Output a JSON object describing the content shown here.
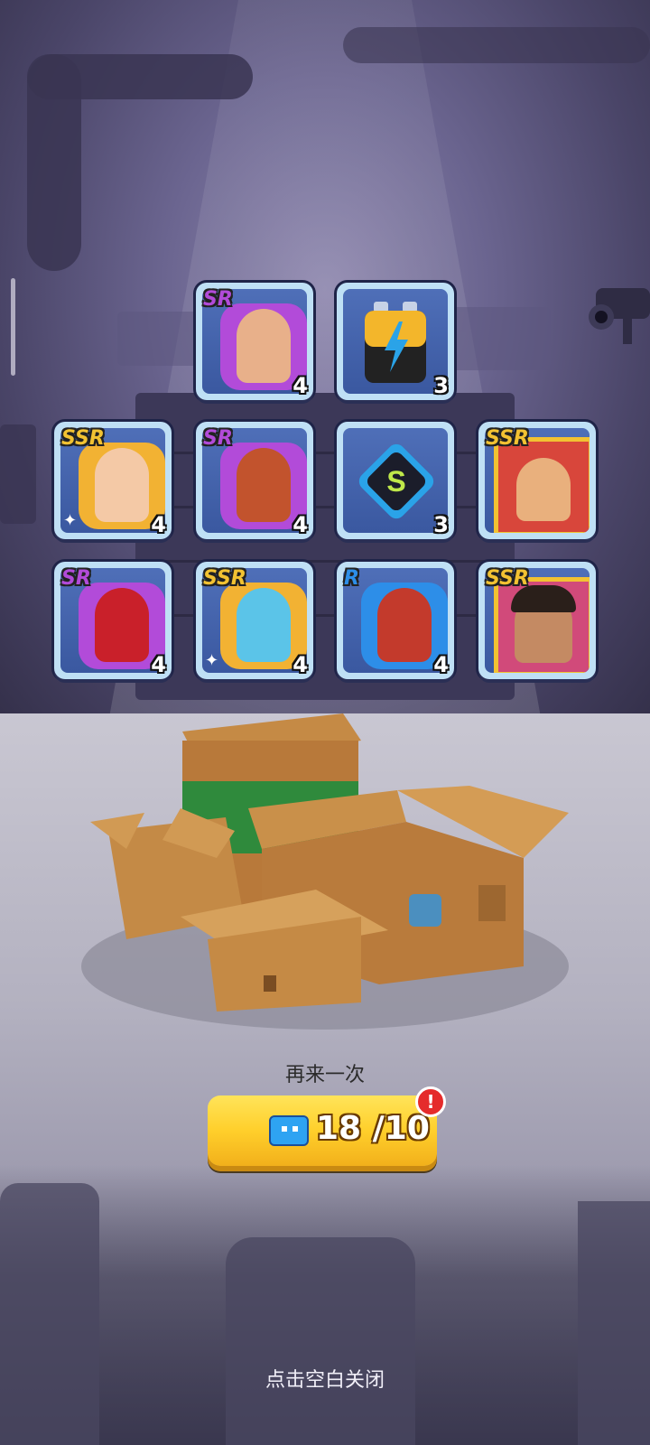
{
  "rewards": [
    {
      "rarity": "SR",
      "count": "4",
      "kind": "hero-shard",
      "color": "#b24bd9"
    },
    {
      "rarity": "",
      "count": "3",
      "kind": "energy-battery",
      "color": "#f3b62b"
    },
    {
      "rarity": "SSR",
      "count": "4",
      "kind": "hero-shard",
      "color": "#f2b233"
    },
    {
      "rarity": "SR",
      "count": "4",
      "kind": "hero-shard",
      "color": "#b24bd9"
    },
    {
      "rarity": "",
      "count": "3",
      "kind": "s-token",
      "color": "#2aa3e8"
    },
    {
      "rarity": "SSR",
      "count": "",
      "kind": "hero-card",
      "color": "#f2c232"
    },
    {
      "rarity": "SR",
      "count": "4",
      "kind": "hero-shard",
      "color": "#b24bd9"
    },
    {
      "rarity": "SSR",
      "count": "4",
      "kind": "hero-shard",
      "color": "#f2b233"
    },
    {
      "rarity": "R",
      "count": "4",
      "kind": "hero-shard",
      "color": "#2d8ee8"
    },
    {
      "rarity": "SSR",
      "count": "",
      "kind": "hero-card",
      "color": "#f2c232"
    }
  ],
  "again": {
    "label": "再来一次",
    "cost": "18 /10",
    "icon": "ticket-icon",
    "alert": "!"
  },
  "close_hint": "点击空白关闭",
  "colors": {
    "button": "#ffcf2b",
    "alert": "#e52b2b",
    "card_border": "#bfe0f5"
  }
}
